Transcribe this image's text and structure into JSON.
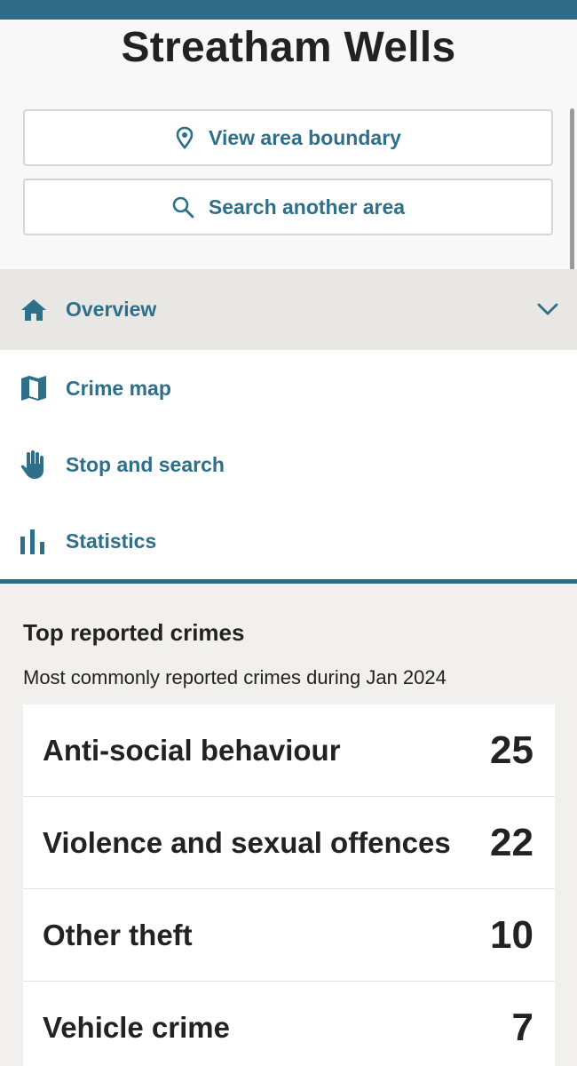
{
  "page": {
    "title": "Streatham Wells"
  },
  "actions": {
    "view_boundary": {
      "label": "View area boundary",
      "icon": "map-pin-icon"
    },
    "search_area": {
      "label": "Search another area",
      "icon": "search-icon"
    }
  },
  "nav": {
    "items": [
      {
        "label": "Overview",
        "icon": "home-icon",
        "active": true
      },
      {
        "label": "Crime map",
        "icon": "map-icon"
      },
      {
        "label": "Stop and search",
        "icon": "hand-icon"
      },
      {
        "label": "Statistics",
        "icon": "bar-chart-icon"
      }
    ]
  },
  "crimes": {
    "title": "Top reported crimes",
    "subtitle": "Most commonly reported crimes during Jan 2024",
    "rows": [
      {
        "name": "Anti-social behaviour",
        "count": "25"
      },
      {
        "name": "Violence and sexual offences",
        "count": "22"
      },
      {
        "name": "Other theft",
        "count": "10"
      },
      {
        "name": "Vehicle crime",
        "count": "7"
      }
    ]
  },
  "colors": {
    "accent": "#316c87",
    "link": "#2e6f8a",
    "active_bg": "#e8e7e4",
    "section_bg": "#f1f0ee"
  }
}
